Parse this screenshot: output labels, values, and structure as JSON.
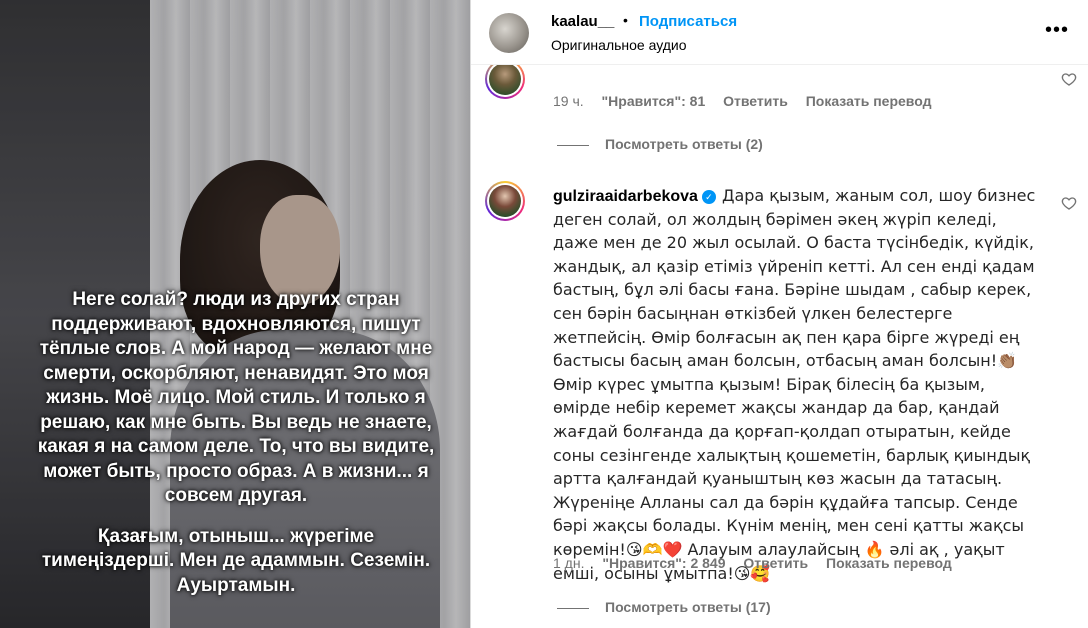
{
  "overlay": {
    "paragraph1": "Неге солай? люди из других стран поддерживают, вдохновляются, пишут тёплые слов. А мой народ — желают мне смерти, оскорбляют, ненавидят. Это моя жизнь. Моё лицо. Мой стиль. И только я решаю, как мне быть. Вы ведь не знаете, какая я на самом деле. То, что вы видите, может быть, просто образ. А в жизни... я совсем другая.",
    "paragraph2": "Қазағым, отыныш... жүрегіме тимеңіздерші. Мен де адаммын. Сеземін. Ауыртамын."
  },
  "header": {
    "username": "kaalau__",
    "dot": "•",
    "follow_label": "Подписаться",
    "audio_label": "Оригинальное аудио",
    "more_icon": "more-horizontal-icon"
  },
  "comment1": {
    "time": "19 ч.",
    "likes": "\"Нравится\": 81",
    "reply_label": "Ответить",
    "translate_label": "Показать перевод",
    "view_replies": "Посмотреть ответы (2)"
  },
  "comment2": {
    "username": "gulziraaidarbekova",
    "text": "Дара қызым, жаным сол, шоу бизнес деген солай, ол жолдың бәрімен әкең жүріп келеді, даже мен де 20 жыл осылай. О баста түсінбедік, күйдік, жандық, ал қазір етіміз үйреніп кетті. Ал сен енді қадам бастың, бұл әлі басы ғана. Бәріне шыдам , сабыр керек, сен бәрін басыңнан өткізбей үлкен белестерге жетпейсің. Өмір болғасын ақ пен қара бірге жүреді ең бастысы басың аман болсын, отбасың аман болсын!👏🏽 Өмір күрес ұмытпа қызым! Бірақ білесің ба қызым, өмірде небір керемет жақсы жандар да бар, қандай жағдай болғанда да қорғап-қолдап отыратын, кейде соны сезінгенде халықтың қошеметін, барлық қиындық артта қалғандай қуаныштың көз жасын да татасың. Жүреніңе Алланы сал да бәрін құдайға тапсыр. Сенде бәрі жақсы болады. Күнім менің, мен сені қатты жақсы көремін!😘🫶❤️ Алауым алаулайсың 🔥 әлі ақ , уақыт емші, осыны ұмытпа!😘🥰",
    "time": "1 дн.",
    "likes": "\"Нравится\": 2 849",
    "reply_label": "Ответить",
    "translate_label": "Показать перевод",
    "view_replies": "Посмотреть ответы (17)"
  }
}
